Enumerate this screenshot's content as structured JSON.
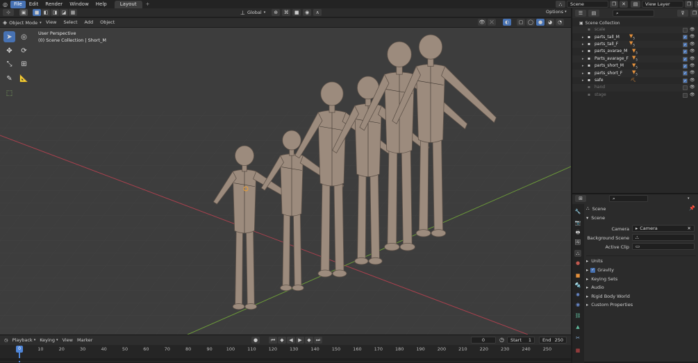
{
  "topbar": {
    "menus": [
      "File",
      "Edit",
      "Render",
      "Window",
      "Help"
    ],
    "workspace_tab": "Layout",
    "add_tab": "+",
    "scene_value": "Scene",
    "view_layer_value": "View Layer"
  },
  "viewport_header": {
    "transform_orientation": "Global",
    "options_label": "Options"
  },
  "viewport_header2": {
    "mode": "Object Mode",
    "menus": [
      "View",
      "Select",
      "Add",
      "Object"
    ]
  },
  "viewport": {
    "perspective_label": "User Perspective",
    "collection_label": "(0) Scene Collection | Short_M"
  },
  "outliner": {
    "root": "Scene Collection",
    "items": [
      {
        "name": "scale",
        "enabled": false,
        "expandable": false
      },
      {
        "name": "parts_tall_M",
        "enabled": true,
        "expandable": true,
        "count": "5"
      },
      {
        "name": "parts_tall_F",
        "enabled": true,
        "expandable": true,
        "count": "5"
      },
      {
        "name": "parts_avarae_M",
        "enabled": true,
        "expandable": true,
        "count": "5"
      },
      {
        "name": "Parts_avarage_F",
        "enabled": true,
        "expandable": true,
        "count": "5"
      },
      {
        "name": "parts_short_M",
        "enabled": true,
        "expandable": true,
        "count": "5"
      },
      {
        "name": "parts_short_F",
        "enabled": true,
        "expandable": true,
        "count": "5"
      },
      {
        "name": "safe",
        "enabled": true,
        "expandable": true
      },
      {
        "name": "hand",
        "enabled": false,
        "expandable": false
      },
      {
        "name": "stage",
        "enabled": false,
        "expandable": false
      }
    ]
  },
  "properties": {
    "context": "Scene",
    "panel_title": "Scene",
    "camera_label": "Camera",
    "camera_value": "Camera",
    "background_scene_label": "Background Scene",
    "active_clip_label": "Active Clip",
    "sections": [
      "Units",
      "Gravity",
      "Keying Sets",
      "Audio",
      "Rigid Body World",
      "Custom Properties"
    ]
  },
  "timeline": {
    "menus": [
      "Playback",
      "Keying",
      "View",
      "Marker"
    ],
    "current_frame": "0",
    "start_label": "Start",
    "start_value": "1",
    "end_label": "End",
    "end_value": "250",
    "ticks": [
      "0",
      "10",
      "20",
      "30",
      "40",
      "50",
      "60",
      "70",
      "80",
      "90",
      "100",
      "110",
      "120",
      "130",
      "140",
      "150",
      "160",
      "170",
      "180",
      "190",
      "200",
      "210",
      "220",
      "230",
      "240",
      "250"
    ]
  },
  "colors": {
    "accent": "#4772b3",
    "viewport_bg": "#3d3d3d",
    "figure": "#9c8b7d",
    "x_axis": "#a8414e",
    "y_axis": "#6c9a3a",
    "playhead": "#4f86d9"
  }
}
